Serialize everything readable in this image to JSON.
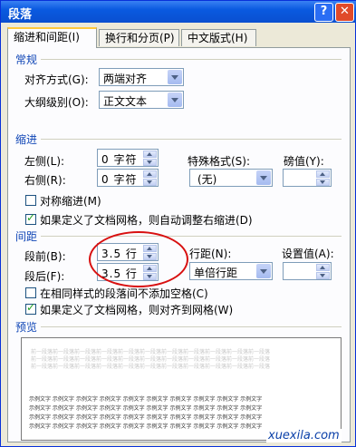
{
  "window": {
    "title": "段落",
    "help_label": "?",
    "close_label": "✕"
  },
  "tabs": [
    {
      "label": "缩进和间距(I)"
    },
    {
      "label": "换行和分页(P)"
    },
    {
      "label": "中文版式(H)"
    }
  ],
  "general": {
    "section_label": "常规",
    "alignment_label": "对齐方式(G):",
    "alignment_value": "两端对齐",
    "outline_label": "大纲级别(O):",
    "outline_value": "正文文本"
  },
  "indent": {
    "section_label": "缩进",
    "left_label": "左侧(L):",
    "left_value": "0 字符",
    "right_label": "右侧(R):",
    "right_value": "0 字符",
    "special_label": "特殊格式(S):",
    "special_value": "(无)",
    "by_label": "磅值(Y):",
    "by_value": "",
    "mirror_label": "对称缩进(M)",
    "mirror_checked": false,
    "auto_adjust_label": "如果定义了文档网格，则自动调整右缩进(D)",
    "auto_adjust_checked": true
  },
  "spacing": {
    "section_label": "间距",
    "before_label": "段前(B):",
    "before_value": "3.5 行",
    "after_label": "段后(F):",
    "after_value": "3.5 行",
    "line_label": "行距(N):",
    "line_value": "单倍行距",
    "at_label": "设置值(A):",
    "at_value": "",
    "no_space_label": "在相同样式的段落间不添加空格(C)",
    "no_space_checked": false,
    "snap_label": "如果定义了文档网格，则对齐到网格(W)",
    "snap_checked": true
  },
  "preview": {
    "section_label": "预览",
    "prev_text": "前一段落前一段落前一段落前一段落前一段落前一段落前一段落前一段落前一段落前一段落前一段落",
    "sample_text": "示例文字  示例文字  示例文字  示例文字  示例文字  示例文字  示例文字  示例文字  示例文字  示例文字"
  },
  "watermark": "xuexila.com",
  "colors": {
    "section": "#1046b6",
    "highlight_circle": "#d81010"
  }
}
